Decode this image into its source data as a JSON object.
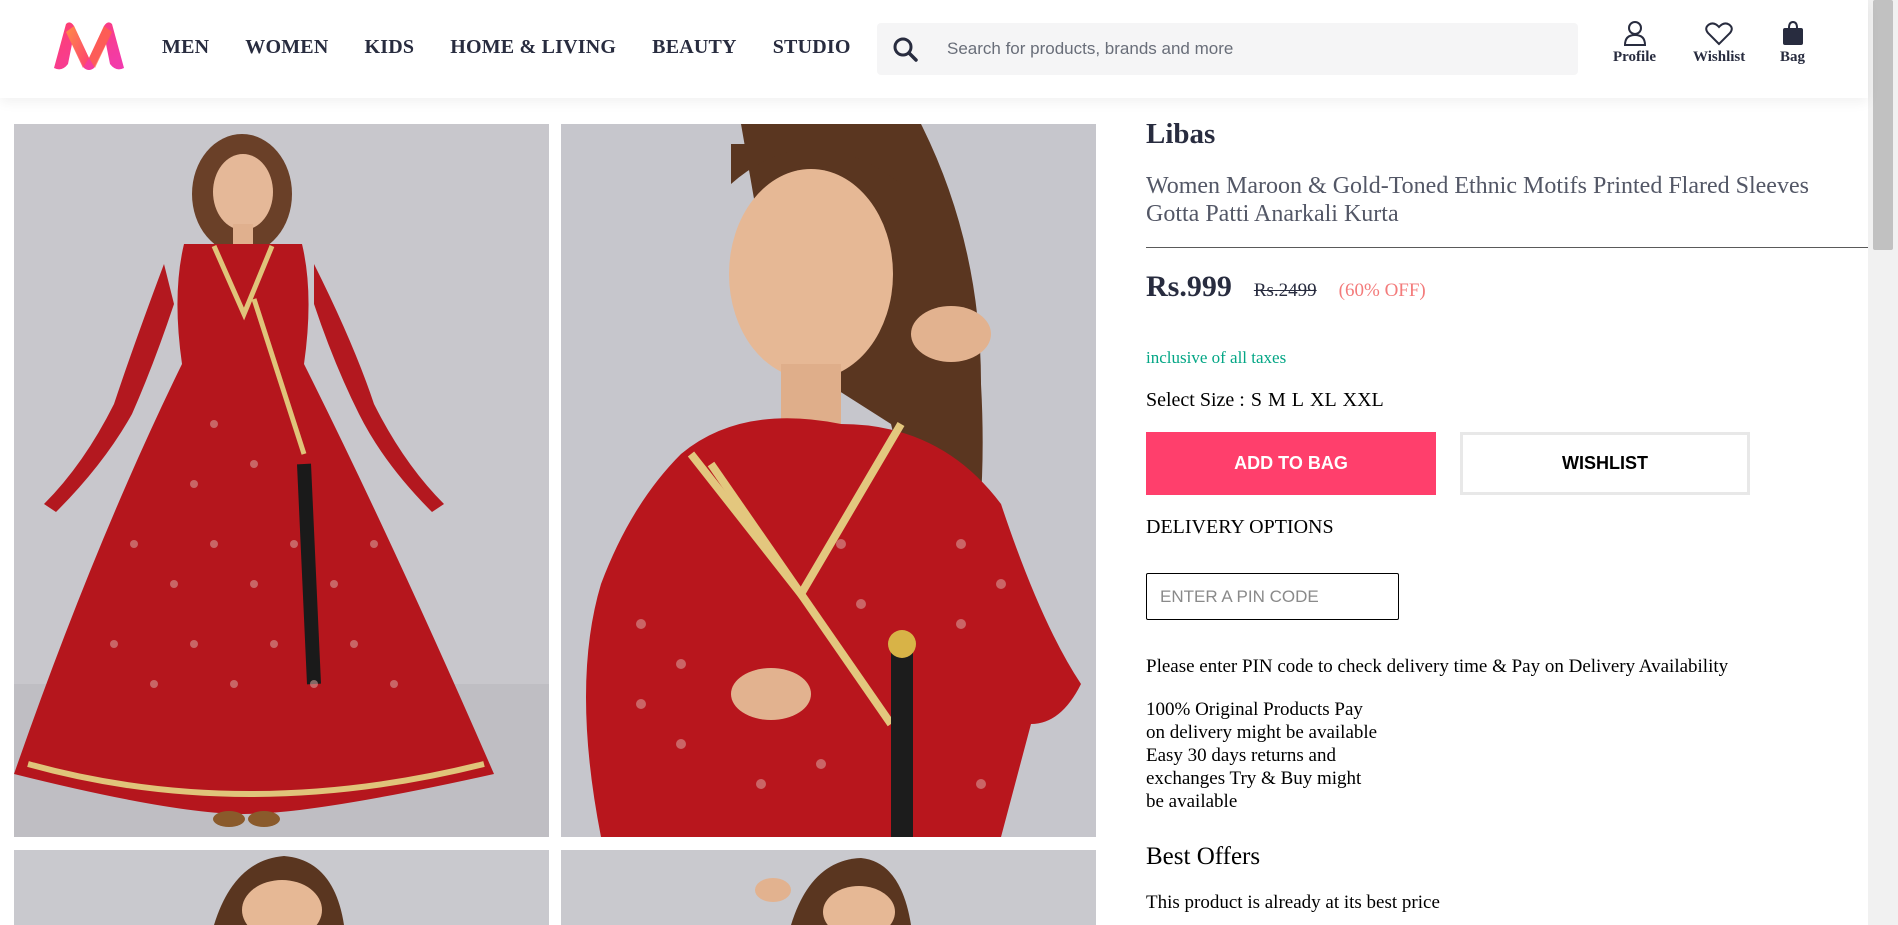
{
  "header": {
    "logo_name": "myntra-logo",
    "nav": [
      "MEN",
      "WOMEN",
      "KIDS",
      "HOME & LIVING",
      "BEAUTY",
      "STUDIO"
    ],
    "search_placeholder": "Search for products, brands and more",
    "actions": {
      "profile": "Profile",
      "wishlist": "Wishlist",
      "bag": "Bag"
    }
  },
  "gallery": {
    "images": [
      "model-full-length-red-anarkali-kurta",
      "model-closeup-red-anarkali-kurta",
      "model-detail-red-anarkali-kurta",
      "model-back-red-anarkali-kurta"
    ]
  },
  "product": {
    "brand": "Libas",
    "name": "Women Maroon & Gold-Toned Ethnic Motifs Printed Flared Sleeves Gotta Patti Anarkali Kurta",
    "price": "Rs.999",
    "mrp": "Rs.2499",
    "discount": "(60% OFF)",
    "taxes_note": "inclusive of all taxes",
    "size_label": "Select Size :",
    "sizes": [
      "S",
      "M",
      "L",
      "XL",
      "XXL"
    ],
    "add_to_bag": "ADD TO BAG",
    "wishlist": "WISHLIST"
  },
  "delivery": {
    "heading": "DELIVERY OPTIONS",
    "pin_placeholder": "ENTER A PIN CODE",
    "note": "Please enter PIN code to check delivery time & Pay on Delivery Availability",
    "assurance": "100% Original Products Pay on delivery might be available Easy 30 days returns and exchanges Try & Buy might be available"
  },
  "offers": {
    "heading": "Best Offers",
    "text": "This product is already at its best price"
  },
  "colors": {
    "brand_pink": "#ff3f6c",
    "tax_green": "#03a685",
    "discount_orange": "#f16565",
    "text_dark": "#282c3f"
  }
}
